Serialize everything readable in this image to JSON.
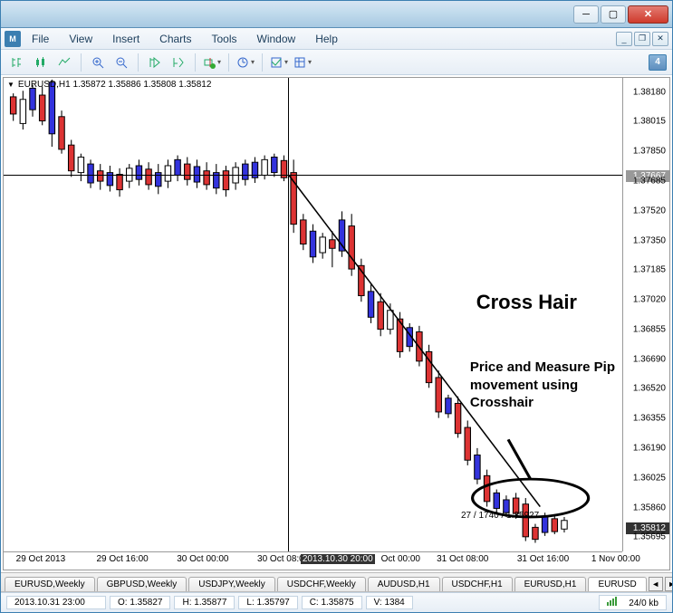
{
  "window": {
    "title": ""
  },
  "menu": {
    "file": "File",
    "view": "View",
    "insert": "Insert",
    "charts": "Charts",
    "tools": "Tools",
    "window": "Window",
    "help": "Help"
  },
  "toolbar": {
    "periodicity_badge": "4"
  },
  "chart": {
    "header": "EURUSD,H1  1.35872  1.35886  1.35808  1.35812",
    "y_labels": [
      "1.38180",
      "1.38015",
      "1.37850",
      "1.37685",
      "1.37520",
      "1.37350",
      "1.37185",
      "1.37020",
      "1.36855",
      "1.36690",
      "1.36520",
      "1.36355",
      "1.36190",
      "1.36025",
      "1.35860",
      "1.35695"
    ],
    "y_marker_line": "1.37667",
    "y_marker_current": "1.35812",
    "x_labels": [
      {
        "text": "29 Oct 2013",
        "pos": 2
      },
      {
        "text": "29 Oct 16:00",
        "pos": 15
      },
      {
        "text": "30 Oct 00:00",
        "pos": 28
      },
      {
        "text": "30 Oct 08:00",
        "pos": 41
      },
      {
        "text": "2013.10.30  20:00",
        "pos": 48,
        "hl": true
      },
      {
        "text": "Oct 00:00",
        "pos": 61
      },
      {
        "text": "31 Oct 08:00",
        "pos": 70
      },
      {
        "text": "31 Oct 16:00",
        "pos": 83
      },
      {
        "text": "1 Nov 00:00",
        "pos": 95
      }
    ],
    "annot_title": "Cross Hair",
    "annot_text_line1": "Price and Measure Pip",
    "annot_text_line2": "movement using",
    "annot_text_line3": "Crosshair",
    "crosshair_readout": "27 / 1740 / 1.35927"
  },
  "tabs": {
    "items": [
      {
        "label": "EURUSD,Weekly"
      },
      {
        "label": "GBPUSD,Weekly"
      },
      {
        "label": "USDJPY,Weekly"
      },
      {
        "label": "USDCHF,Weekly"
      },
      {
        "label": "AUDUSD,H1"
      },
      {
        "label": "USDCHF,H1"
      },
      {
        "label": "EURUSD,H1"
      },
      {
        "label": "EURUSD"
      }
    ],
    "active_index": 7
  },
  "status": {
    "datetime": "2013.10.31 23:00",
    "open": "O: 1.35827",
    "high": "H: 1.35877",
    "low": "L: 1.35797",
    "close": "C: 1.35875",
    "vol": "V: 1384",
    "traffic": "24/0 kb"
  },
  "chart_data": {
    "type": "candlestick",
    "symbol": "EURUSD",
    "timeframe": "H1",
    "xrange": [
      "2013-10-29 00:00",
      "2013-11-01 04:00"
    ],
    "yrange": [
      1.35695,
      1.3818
    ],
    "horizontal_line": 1.37667,
    "crosshair_vertical_time": "2013-10-30 20:00",
    "crosshair_measure": {
      "bars": 27,
      "points": 1740,
      "price": 1.35927
    },
    "candles_sample": [
      {
        "t": "2013-10-29 00:00",
        "o": 1.3788,
        "h": 1.3793,
        "l": 1.3777,
        "c": 1.3784
      },
      {
        "t": "2013-10-29 02:00",
        "o": 1.3784,
        "h": 1.381,
        "l": 1.378,
        "c": 1.3805
      },
      {
        "t": "2013-10-29 03:00",
        "o": 1.3805,
        "h": 1.3812,
        "l": 1.3775,
        "c": 1.3778
      },
      {
        "t": "2013-10-30 20:00",
        "o": 1.3767,
        "h": 1.377,
        "l": 1.3728,
        "c": 1.373
      },
      {
        "t": "2013-10-31 08:00",
        "o": 1.368,
        "h": 1.3695,
        "l": 1.3648,
        "c": 1.3652
      },
      {
        "t": "2013-10-31 23:00",
        "o": 1.35827,
        "h": 1.35877,
        "l": 1.35797,
        "c": 1.35875
      }
    ]
  }
}
